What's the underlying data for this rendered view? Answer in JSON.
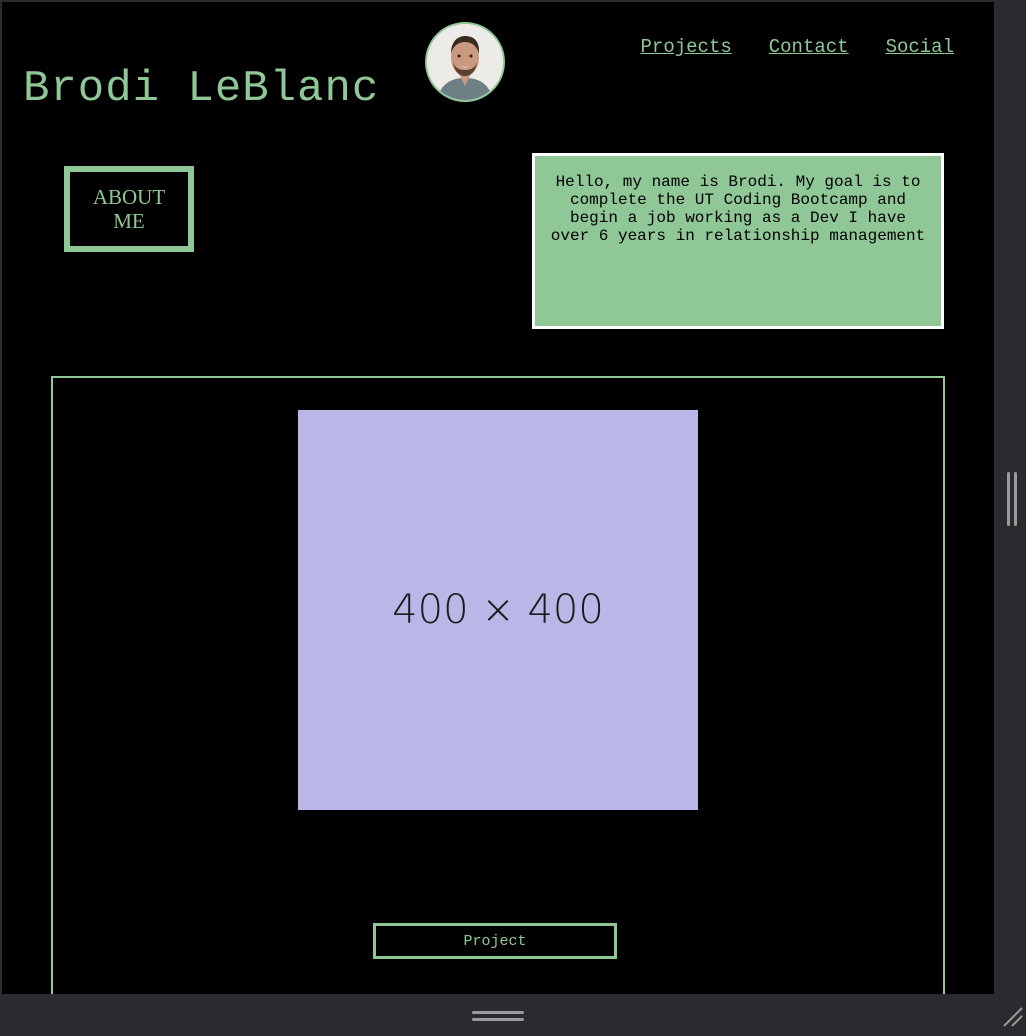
{
  "header": {
    "title": "Brodi LeBlanc",
    "avatar_icon": "person-portrait-icon"
  },
  "nav": {
    "items": [
      {
        "label": "Projects"
      },
      {
        "label": "Contact"
      },
      {
        "label": "Social"
      }
    ]
  },
  "about": {
    "heading": "ABOUT ME",
    "bio": "Hello, my name is Brodi. My goal is to complete the UT Coding Bootcamp and begin a job working as a Dev I have over 6 years in relationship management"
  },
  "project": {
    "placeholder_label": "400 × 400",
    "button_label": "Project"
  },
  "colors": {
    "background": "#000000",
    "accent_green": "#8fc896",
    "placeholder_bg": "#b8b7e7",
    "bio_border": "#ffffff"
  }
}
